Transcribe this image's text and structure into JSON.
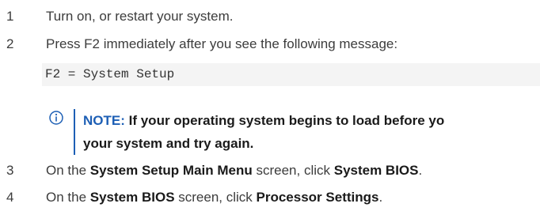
{
  "steps": [
    {
      "number": "1",
      "text": "Turn on, or restart your system."
    },
    {
      "number": "2",
      "text": "Press F2 immediately after you see the following message:"
    },
    {
      "number": "3",
      "prefix": "On the ",
      "bold1": "System Setup Main Menu",
      "middle": " screen, click ",
      "bold2": "System BIOS",
      "suffix": "."
    },
    {
      "number": "4",
      "prefix": "On the ",
      "bold1": "System BIOS",
      "middle": " screen, click ",
      "bold2": "Processor Settings",
      "suffix": "."
    }
  ],
  "code_message": "F2 = System Setup",
  "note": {
    "label": "NOTE:",
    "line1": "If your operating system begins to load before yo",
    "line2": "your system and try again.",
    "icon": "info-icon",
    "accent_color": "#1d5fb5"
  }
}
